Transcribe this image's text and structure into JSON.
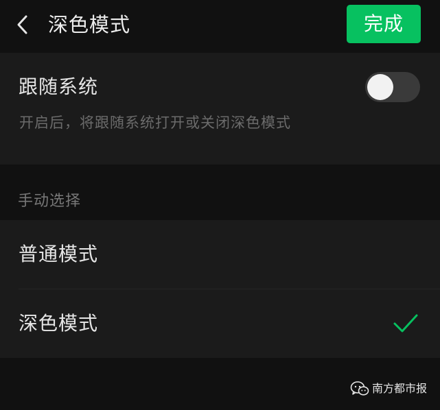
{
  "header": {
    "title": "深色模式",
    "done_label": "完成",
    "back_icon": "chevron-left-icon"
  },
  "follow_system": {
    "label": "跟随系统",
    "description": "开启后，将跟随系统打开或关闭深色模式",
    "enabled": false
  },
  "manual": {
    "section_label": "手动选择",
    "options": [
      {
        "label": "普通模式",
        "selected": false
      },
      {
        "label": "深色模式",
        "selected": true
      }
    ]
  },
  "watermark": {
    "text": "南方都市报",
    "icon": "wechat-icon"
  },
  "colors": {
    "accent": "#07c160",
    "background": "#111111",
    "panel": "#1b1b1b"
  }
}
